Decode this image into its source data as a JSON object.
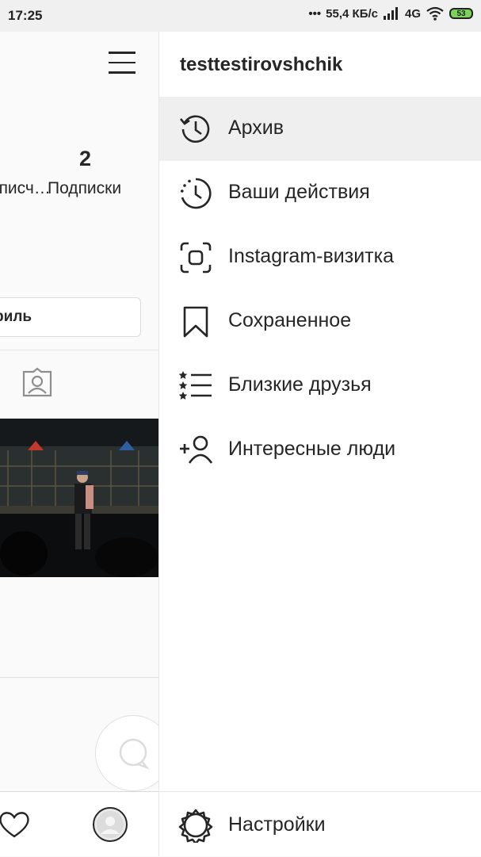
{
  "status_bar": {
    "time": "17:25",
    "speed": "55,4 КБ/с",
    "network": "4G",
    "battery": "53"
  },
  "profile": {
    "followers_label": "Подписч…",
    "following_count": "2",
    "following_label": "Подписки",
    "edit_button_label": "Редактировать профиль"
  },
  "drawer": {
    "username": "testtestirovshchik",
    "items": [
      {
        "label": "Архив",
        "icon": "archive-icon"
      },
      {
        "label": "Ваши действия",
        "icon": "activity-icon"
      },
      {
        "label": "Instagram-визитка",
        "icon": "nametag-icon"
      },
      {
        "label": "Сохраненное",
        "icon": "bookmark-icon"
      },
      {
        "label": "Близкие друзья",
        "icon": "close-friends-icon"
      },
      {
        "label": "Интересные люди",
        "icon": "discover-people-icon"
      }
    ],
    "settings_label": "Настройки"
  },
  "colors": {
    "active_item_bg": "#efefef",
    "text": "#262626",
    "battery_fill": "#7bd35a"
  }
}
